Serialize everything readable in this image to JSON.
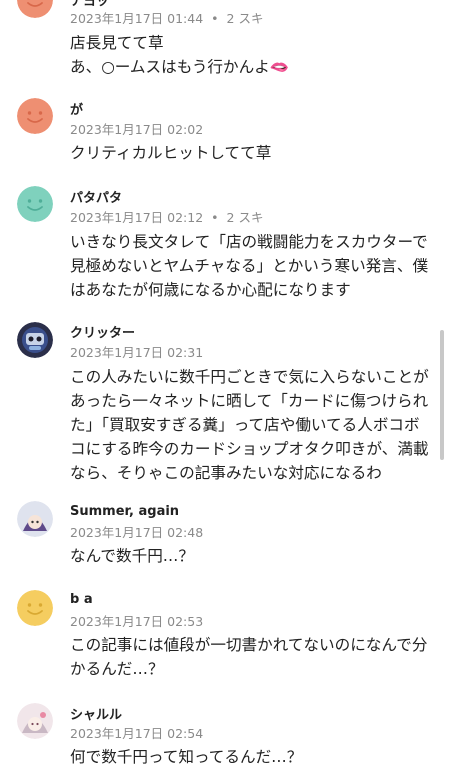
{
  "comments": [
    {
      "name": "ナヨッ",
      "date": "2023年1月17日 01:44",
      "likes": "2 スキ",
      "lines": [
        "店長見てて草",
        "あ、○ームスはもう行かんよ🫦"
      ]
    },
    {
      "name": "が",
      "date": "2023年1月17日 02:02",
      "likes": "",
      "lines": [
        "クリティカルヒットしてて草"
      ]
    },
    {
      "name": "パタパタ",
      "date": "2023年1月17日 02:12",
      "likes": "2 スキ",
      "lines": [
        "いきなり長文タレて「店の戦闘能力をスカウターで",
        "見極めないとヤムチャなる」とかいう寒い発言、僕",
        "はあなたが何歳になるか心配になります"
      ]
    },
    {
      "name": "クリッター",
      "date": "2023年1月17日 02:31",
      "likes": "",
      "lines": [
        "この人みたいに数千円ごときで気に入らないことが",
        "あったら一々ネットに晒して「カードに傷つけられ",
        "た」「買取安すぎる糞」って店や働いてる人ボコボ",
        "コにする昨今のカードショップオタク叩きが、満載",
        "なら、そりゃこの記事みたいな対応になるわ"
      ]
    },
    {
      "name": "Summer, again",
      "date": "2023年1月17日 02:48",
      "likes": "",
      "lines": [
        "なんで数千円…？"
      ]
    },
    {
      "name": "b a",
      "date": "2023年1月17日 02:53",
      "likes": "",
      "lines": [
        "この記事には値段が一切書かれてないのになんで分",
        "かるんだ…？"
      ]
    },
    {
      "name": "シャルル",
      "date": "2023年1月17日 02:54",
      "likes": "",
      "lines": [
        "何で数千円って知ってるんだ…？"
      ]
    }
  ],
  "separator": "•",
  "colors": {
    "avatar_orange": "#ee8f72",
    "avatar_teal": "#7fd1bd",
    "avatar_yellow": "#f5cd60",
    "meta_gray": "#8a8a8a"
  }
}
